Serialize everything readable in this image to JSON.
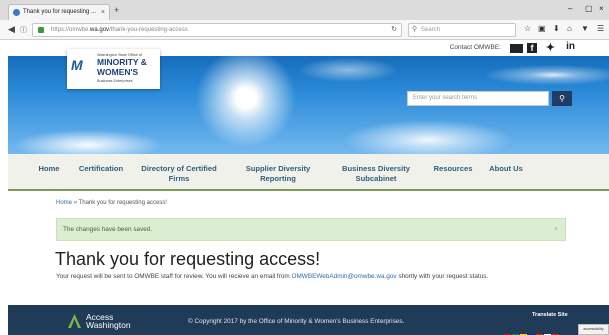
{
  "browser": {
    "tab_title": "Thank you for requesting ...",
    "tab_close": "×",
    "new_tab": "+",
    "win_min": "–",
    "win_max": "▢",
    "win_close": "×",
    "url_prefix": "https://omwbe.",
    "url_domain": "wa.gov",
    "url_path": "/thank-you-requesting-access",
    "search_placeholder": "Search",
    "icons": [
      "back-icon",
      "star-icon",
      "reading-list-icon",
      "download-icon",
      "home-icon",
      "pocket-icon",
      "menu-icon"
    ]
  },
  "site": {
    "contact_label": "Contact OMWBE:",
    "logo": {
      "line1": "Washington State Office of",
      "line2": "MINORITY &",
      "line3": "WOMEN'S",
      "line4": "Business Enterprises"
    },
    "search_placeholder": "Enter your search terms",
    "nav": [
      {
        "label": "Home"
      },
      {
        "label": "Certification"
      },
      {
        "label": "Directory of Certified Firms"
      },
      {
        "label": "Supplier Diversity Reporting"
      },
      {
        "label": "Business Diversity Subcabinet"
      },
      {
        "label": "Resources"
      },
      {
        "label": "About Us"
      }
    ]
  },
  "content": {
    "breadcrumb_home": "Home",
    "breadcrumb_sep": "»",
    "breadcrumb_current": "Thank you for requesting access!",
    "alert_text": "The changes have been saved.",
    "alert_close": "×",
    "title": "Thank you for requesting access!",
    "review_text_1": "Your request will be sent to OMWBE staff for review.  You will recieve an email from ",
    "review_email": "OMWBEWebAdmin@omwbe.wa.gov",
    "review_text_2": " shortly with your request status."
  },
  "footer": {
    "aw_line1": "Access",
    "aw_line2": "Washington",
    "copyright": "© Copyright 2017 by the Office of Minority & Women's Business Enterprises.",
    "translate_label": "Translate Site",
    "corner_label": "accessibility"
  },
  "colors": {
    "nav_text": "#2f5e7a",
    "footer_bg": "#1f3b58",
    "alert_bg": "#dbeed2",
    "link": "#2e6ca8"
  }
}
